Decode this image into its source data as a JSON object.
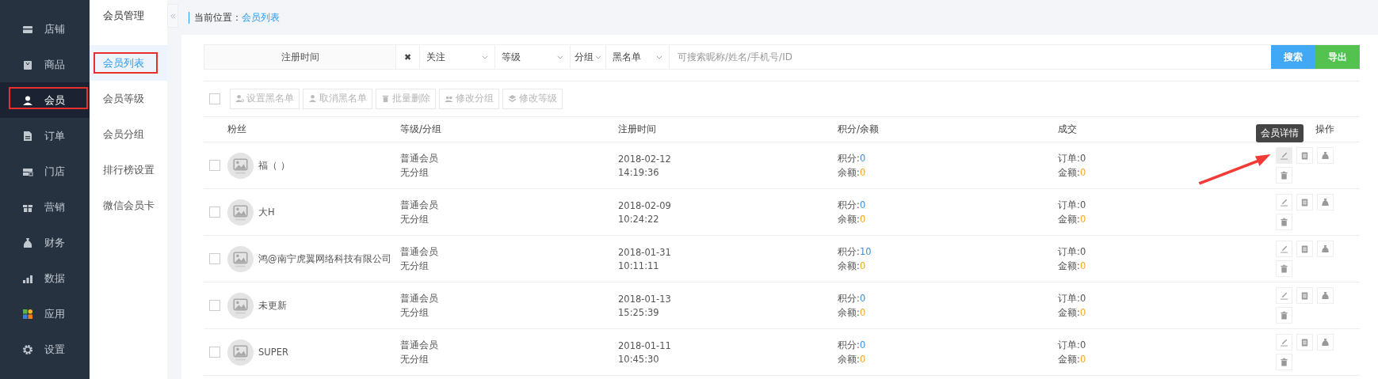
{
  "sidebar": {
    "items": [
      {
        "label": "店铺",
        "selected": false,
        "highlighted": false
      },
      {
        "label": "商品",
        "selected": false,
        "highlighted": false
      },
      {
        "label": "会员",
        "selected": true,
        "highlighted": true
      },
      {
        "label": "订单",
        "selected": false,
        "highlighted": false
      },
      {
        "label": "门店",
        "selected": false,
        "highlighted": false
      },
      {
        "label": "营销",
        "selected": false,
        "highlighted": false
      },
      {
        "label": "财务",
        "selected": false,
        "highlighted": false
      },
      {
        "label": "数据",
        "selected": false,
        "highlighted": false
      },
      {
        "label": "应用",
        "selected": false,
        "highlighted": false
      },
      {
        "label": "设置",
        "selected": false,
        "highlighted": false
      }
    ]
  },
  "subnav": {
    "title": "会员管理",
    "items": [
      {
        "label": "会员列表",
        "selected": true,
        "highlighted": true
      },
      {
        "label": "会员等级",
        "selected": false,
        "highlighted": false
      },
      {
        "label": "会员分组",
        "selected": false,
        "highlighted": false
      },
      {
        "label": "排行榜设置",
        "selected": false,
        "highlighted": false
      },
      {
        "label": "微信会员卡",
        "selected": false,
        "highlighted": false
      }
    ]
  },
  "breadcrumb": {
    "label": "当前位置：",
    "current": "会员列表"
  },
  "filters": {
    "date": "注册时间",
    "clear": "✖",
    "selects": [
      "关注",
      "等级",
      "分组",
      "黑名单"
    ],
    "search_placeholder": "可搜索昵称/姓名/手机号/ID",
    "buttons": [
      {
        "label": "搜索",
        "kind": "search"
      },
      {
        "label": "导出",
        "kind": "export"
      }
    ]
  },
  "batch": {
    "checked": false,
    "disabled": true,
    "actions": [
      {
        "label": "设置黑名单"
      },
      {
        "label": "取消黑名单"
      },
      {
        "label": "批量删除"
      },
      {
        "label": "修改分组"
      },
      {
        "label": "修改等级"
      }
    ]
  },
  "table": {
    "columns": [
      "粉丝",
      "等级/分组",
      "注册时间",
      "积分/余额",
      "成交",
      "操作"
    ],
    "rows": [
      {
        "checked": false,
        "name": "福（ ）",
        "level": "普通会员",
        "group": "无分组",
        "date": "2018-02-12",
        "time": "14:19:36",
        "points": {
          "label": "积分:",
          "value": "0"
        },
        "balance": {
          "label": "余额:",
          "value": "0"
        },
        "orders": {
          "label": "订单:",
          "value": "0"
        },
        "amount": {
          "label": "金额:",
          "value": "0"
        },
        "tooltip": "会员详情"
      },
      {
        "checked": false,
        "name": "大H",
        "level": "普通会员",
        "group": "无分组",
        "date": "2018-02-09",
        "time": "10:24:22",
        "points": {
          "label": "积分:",
          "value": "0"
        },
        "balance": {
          "label": "余额:",
          "value": "0"
        },
        "orders": {
          "label": "订单:",
          "value": "0"
        },
        "amount": {
          "label": "金额:",
          "value": "0"
        }
      },
      {
        "checked": false,
        "name": "鸿@南宁虎翼网络科技有限公司",
        "level": "普通会员",
        "group": "无分组",
        "date": "2018-01-31",
        "time": "10:11:11",
        "points": {
          "label": "积分:",
          "value": "10"
        },
        "balance": {
          "label": "余额:",
          "value": "0"
        },
        "orders": {
          "label": "订单:",
          "value": "0"
        },
        "amount": {
          "label": "金额:",
          "value": "0"
        }
      },
      {
        "checked": false,
        "name": "未更新",
        "level": "普通会员",
        "group": "无分组",
        "date": "2018-01-13",
        "time": "15:25:39",
        "points": {
          "label": "积分:",
          "value": "0"
        },
        "balance": {
          "label": "余额:",
          "value": "0"
        },
        "orders": {
          "label": "订单:",
          "value": "0"
        },
        "amount": {
          "label": "金额:",
          "value": "0"
        }
      },
      {
        "checked": false,
        "name": "SUPER",
        "level": "普通会员",
        "group": "无分组",
        "date": "2018-01-11",
        "time": "10:45:30",
        "points": {
          "label": "积分:",
          "value": "0"
        },
        "balance": {
          "label": "余额:",
          "value": "0"
        },
        "orders": {
          "label": "订单:",
          "value": "0"
        },
        "amount": {
          "label": "金额:",
          "value": "0"
        }
      }
    ]
  }
}
